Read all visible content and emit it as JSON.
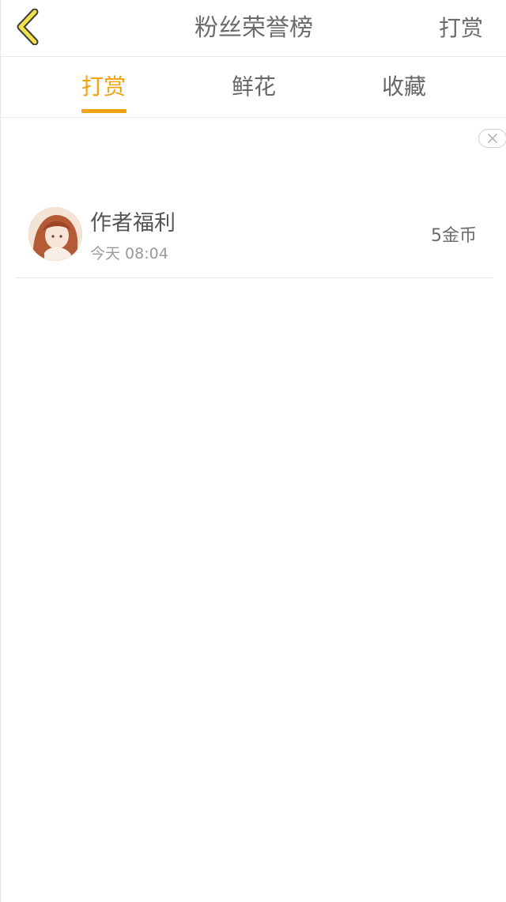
{
  "header": {
    "title": "粉丝荣誉榜",
    "action_label": "打赏"
  },
  "tabs": [
    {
      "label": "打赏",
      "active": true
    },
    {
      "label": "鲜花",
      "active": false
    },
    {
      "label": "收藏",
      "active": false
    }
  ],
  "records": [
    {
      "name": "作者福利",
      "time": "今天 08:04",
      "amount": "5金币"
    }
  ],
  "colors": {
    "accent": "#f0a20f",
    "text": "#6b6b6b",
    "subtext": "#9a9a9a",
    "back_icon": "#f2e24a"
  },
  "icons": {
    "back": "chevron-left-icon",
    "close": "close-icon"
  }
}
